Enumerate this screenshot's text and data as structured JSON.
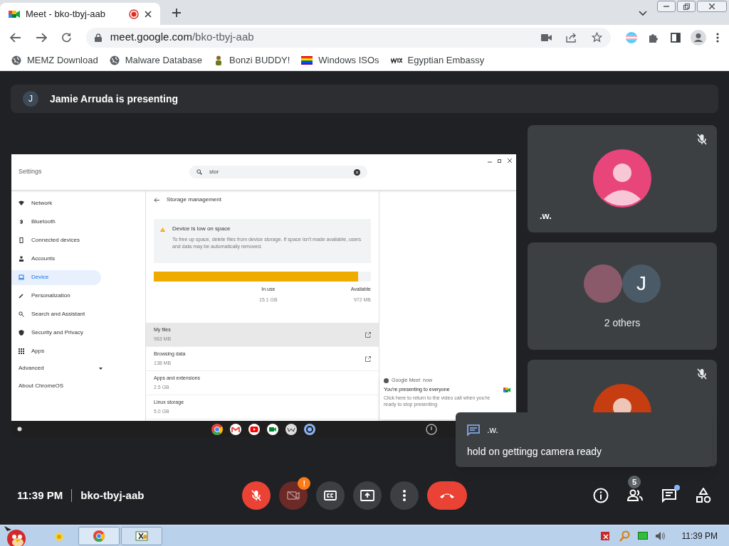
{
  "browser": {
    "tab": {
      "title": "Meet - bko-tbyj-aab",
      "recording": true
    },
    "url": {
      "host": "meet.google.com",
      "path": "/bko-tbyj-aab"
    },
    "bookmarks": [
      {
        "label": "MEMZ Download"
      },
      {
        "label": "Malware Database"
      },
      {
        "label": "Bonzi BUDDY!"
      },
      {
        "label": "Windows ISOs"
      },
      {
        "label": "Egyptian Embassy"
      }
    ]
  },
  "meet": {
    "presenter_banner": {
      "initial": "J",
      "text": "Jamie Arruda is presenting"
    },
    "shared_screen": {
      "title": "Settings",
      "search": "stor",
      "nav": [
        {
          "label": "Network",
          "selected": false
        },
        {
          "label": "Bluetooth",
          "selected": false
        },
        {
          "label": "Connected devices",
          "selected": false
        },
        {
          "label": "Accounts",
          "selected": false
        },
        {
          "label": "Device",
          "selected": true
        },
        {
          "label": "Personalization",
          "selected": false
        },
        {
          "label": "Search and Assistant",
          "selected": false
        },
        {
          "label": "Security and Privacy",
          "selected": false
        },
        {
          "label": "Apps",
          "selected": false
        }
      ],
      "advanced": "Advanced",
      "about": "About ChromeOS",
      "page_title": "Storage management",
      "warning": {
        "title": "Device is low on space",
        "text": "To free up space, delete files from device storage. If space isn't made available, users and data may be automatically removed."
      },
      "storage": {
        "level": 0.94,
        "in_use_label": "In use",
        "in_use": "15.1 GB",
        "available_label": "Available",
        "available": "972 MB"
      },
      "rows": [
        {
          "label": "My files",
          "size": "963 MB",
          "hovered": true,
          "link": true
        },
        {
          "label": "Browsing data",
          "size": "138 MB",
          "hovered": false,
          "link": true
        },
        {
          "label": "Apps and extensions",
          "size": "2.5 GB",
          "hovered": false,
          "link": false
        },
        {
          "label": "Linux storage",
          "size": "5.0 GB",
          "hovered": false,
          "link": false
        }
      ],
      "notification": {
        "app": "Google Meet",
        "time": "now",
        "title": "You're presenting to everyone",
        "text": "Click here to return to the video call when you're ready to stop presenting"
      }
    },
    "tiles": [
      {
        "kind": "avatar",
        "name": ".w.",
        "muted": true,
        "color": "#e8457b"
      },
      {
        "kind": "group",
        "initial": "J",
        "label": "2 others",
        "muted": false
      },
      {
        "kind": "avatar",
        "muted": true,
        "color": "#c53d10"
      }
    ],
    "chat_toast": {
      "sender": ".w.",
      "message": "hold on gettingg camera ready"
    },
    "bottom_bar": {
      "time": "11:39 PM",
      "meeting_code": "bko-tbyj-aab",
      "mic_on": false,
      "camera_on": false,
      "camera_alert": "!",
      "people_count": "5",
      "chat_unread": true
    }
  },
  "taskbar": {
    "clock": "11:39 PM"
  }
}
